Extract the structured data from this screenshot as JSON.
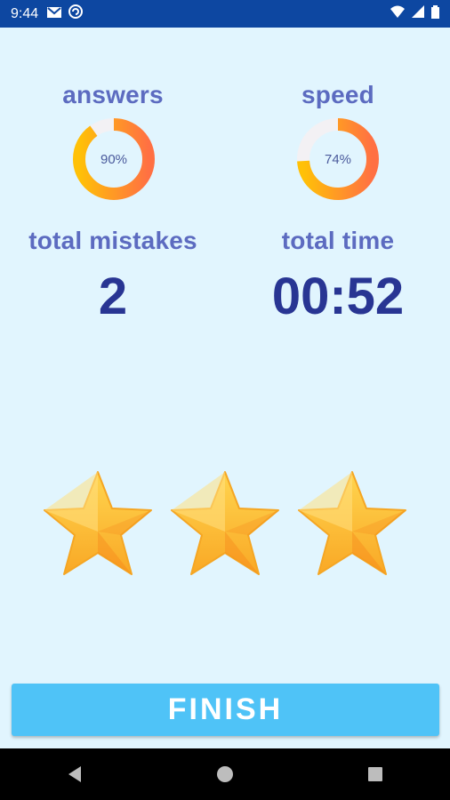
{
  "status_bar": {
    "time": "9:44",
    "icons": [
      "gmail-icon",
      "sync-icon",
      "wifi-icon",
      "signal-icon",
      "battery-icon"
    ]
  },
  "stats": {
    "answers": {
      "label": "answers",
      "percent_text": "90%",
      "value": 0.9
    },
    "speed": {
      "label": "speed",
      "percent_text": "74%",
      "value": 0.74
    },
    "mistakes": {
      "label": "total mistakes",
      "value": "2"
    },
    "time": {
      "label": "total time",
      "value": "00:52"
    }
  },
  "rating": {
    "stars": 3,
    "max": 3
  },
  "finish_button": {
    "label": "FINISH"
  },
  "colors": {
    "background": "#e1f5fe",
    "status_bar": "#0d47a1",
    "label": "#5c6bc0",
    "number": "#283593",
    "ring_start": "#ffc107",
    "ring_end": "#ff7043",
    "button": "#4fc3f7"
  },
  "nav_bar": {
    "icons": [
      "back-icon",
      "home-icon",
      "recents-icon"
    ]
  }
}
